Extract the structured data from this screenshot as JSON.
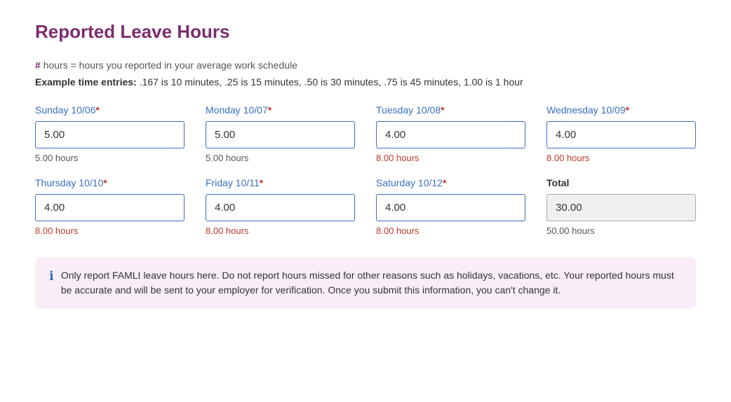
{
  "page": {
    "title": "Reported Leave Hours",
    "info_line": "# hours = hours you reported in your average work schedule",
    "info_hash": "#",
    "example_label": "Example time entries:",
    "example_text": " .167 is 10 minutes, .25 is 15 minutes, .50 is 30 minutes, .75 is 45 minutes, 1.00 is 1 hour"
  },
  "fields": [
    {
      "id": "sunday",
      "label": "Sunday 10/06",
      "required": true,
      "value": "5.00",
      "hours": "5.00 hours",
      "hours_warning": false
    },
    {
      "id": "monday",
      "label": "Monday 10/07",
      "required": true,
      "value": "5.00",
      "hours": "5.00 hours",
      "hours_warning": false
    },
    {
      "id": "tuesday",
      "label": "Tuesday 10/08",
      "required": true,
      "value": "4.00",
      "hours": "8.00 hours",
      "hours_warning": true
    },
    {
      "id": "wednesday",
      "label": "Wednesday 10/09",
      "required": true,
      "value": "4.00",
      "hours": "8.00 hours",
      "hours_warning": true
    },
    {
      "id": "thursday",
      "label": "Thursday 10/10",
      "required": true,
      "value": "4.00",
      "hours": "8.00 hours",
      "hours_warning": true
    },
    {
      "id": "friday",
      "label": "Friday 10/11",
      "required": true,
      "value": "4.00",
      "hours": "8.00 hours",
      "hours_warning": true
    },
    {
      "id": "saturday",
      "label": "Saturday 10/12",
      "required": true,
      "value": "4.00",
      "hours": "8.00 hours",
      "hours_warning": true
    },
    {
      "id": "total",
      "label": "Total",
      "required": false,
      "value": "30.00",
      "hours": "50.00 hours",
      "hours_warning": false,
      "is_total": true
    }
  ],
  "notice": {
    "icon": "ℹ",
    "text": "Only report FAMLI leave hours here. Do not report hours missed for other reasons such as holidays, vacations, etc. Your reported hours must be accurate and will be sent to your employer for verification. Once you submit this information, you can't change it."
  }
}
